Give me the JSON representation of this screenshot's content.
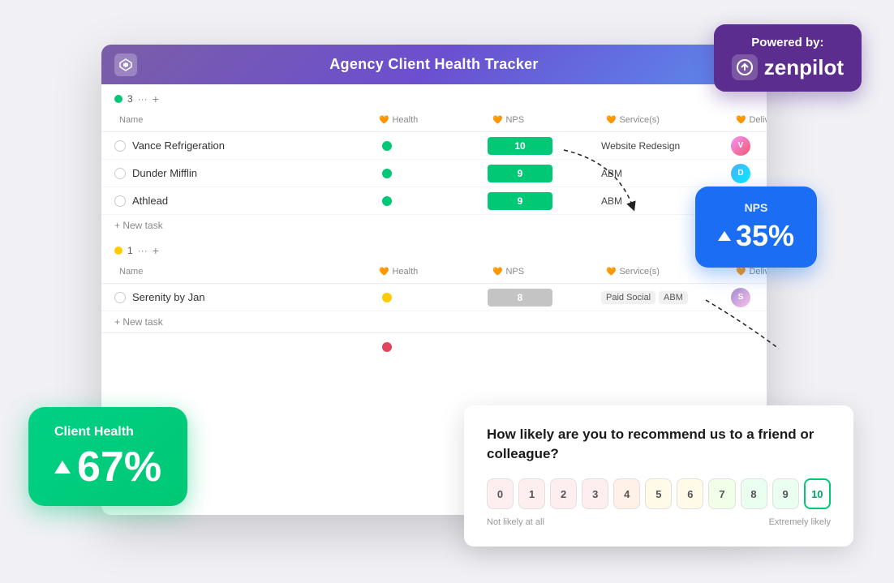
{
  "app": {
    "title": "Agency Client Health Tracker",
    "logo_symbol": "⟳"
  },
  "zenpilot": {
    "powered_by": "Powered by:",
    "name": "zenpilot"
  },
  "nps_bubble": {
    "label": "NPS",
    "value": "35%"
  },
  "health_bubble": {
    "label": "Client Health",
    "value": "67%"
  },
  "survey": {
    "question": "How likely are you to recommend us to a friend or colleague?",
    "not_likely": "Not likely at all",
    "very_likely": "Extremely likely",
    "scale": [
      "0",
      "1",
      "2",
      "3",
      "4",
      "5",
      "6",
      "7",
      "8",
      "9",
      "10"
    ],
    "selected": "10"
  },
  "group1": {
    "dot_color": "green",
    "count": "3",
    "columns": [
      "Name",
      "Health",
      "NPS",
      "Service(s)",
      "Delivery Lead"
    ],
    "rows": [
      {
        "name": "Vance Refrigeration",
        "health": "green",
        "nps": "10",
        "nps_color": "green",
        "services": [
          "Website Redesign"
        ],
        "avatar_color": "pink"
      },
      {
        "name": "Dunder Mifflin",
        "health": "green",
        "nps": "9",
        "nps_color": "green",
        "services": [
          "ABM"
        ],
        "avatar_color": "blue"
      },
      {
        "name": "Athlead",
        "health": "green",
        "nps": "9",
        "nps_color": "green",
        "services": [
          "ABM"
        ],
        "avatar_color": "orange"
      }
    ],
    "new_task": "+ New task"
  },
  "group2": {
    "dot_color": "yellow",
    "count": "1",
    "columns": [
      "Name",
      "Health",
      "NPS",
      "Service(s)",
      "Delivery Lead"
    ],
    "rows": [
      {
        "name": "Serenity by Jan",
        "health": "yellow",
        "nps": "8",
        "nps_color": "gray",
        "services": [
          "Paid Social",
          "ABM"
        ],
        "avatar_color": "purple"
      }
    ],
    "new_task": "+ New task"
  },
  "group3": {
    "health": "red"
  }
}
